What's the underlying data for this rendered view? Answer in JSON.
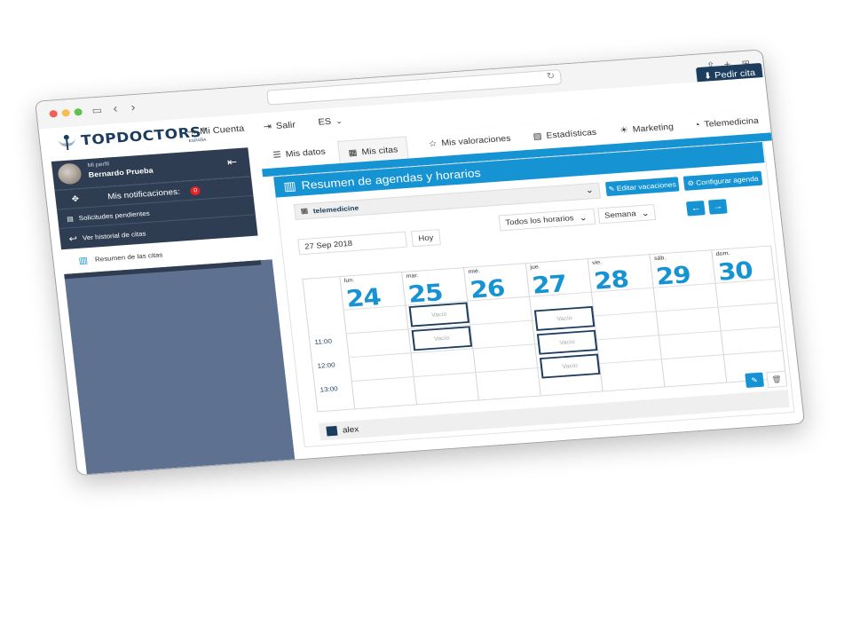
{
  "browser": {
    "pedir_cita": "Pedir cita"
  },
  "brand": {
    "logo_top": "TOP",
    "logo_doctors": "DOCTORS",
    "logo_sub": "ESPAÑA",
    "reg": "®",
    "accent_color": "#1593d3",
    "dark_color": "#1c3d5e"
  },
  "topnav": {
    "mi_cuenta": "Mi Cuenta",
    "salir": "Salir",
    "lang": "ES"
  },
  "sidebar": {
    "profile_caption": "Mi perfil",
    "profile_name": "Bernardo Prueba",
    "notifications_label": "Mis notificaciones:",
    "notifications_count": "0",
    "items": [
      {
        "label": "Solicitudes pendientes",
        "icon": "clipboard-icon"
      },
      {
        "label": "Ver historial de citas",
        "icon": "reply-icon"
      },
      {
        "label": "Resumen de las citas",
        "icon": "agenda-icon"
      }
    ]
  },
  "tabs": [
    {
      "label": "Mis datos",
      "icon": "list-icon"
    },
    {
      "label": "Mis citas",
      "icon": "calendar-icon"
    },
    {
      "label": "Mis valoraciones",
      "icon": "star-icon"
    },
    {
      "label": "Estadísticas",
      "icon": "chart-icon"
    },
    {
      "label": "Marketing",
      "icon": "bulb-icon"
    },
    {
      "label": "Telemedicina",
      "icon": "chat-icon"
    }
  ],
  "panel": {
    "title": "Resumen de agendas y horarios",
    "agenda_select": "telemedicine",
    "edit_vacations": "Editar vacaciones",
    "configure_agenda": "Configurar agenda",
    "date_value": "27 Sep 2018",
    "today": "Hoy",
    "schedule_select": "Todos los horarios",
    "view_select": "Semana",
    "prev_arrow": "←",
    "next_arrow": "→"
  },
  "calendar": {
    "days": [
      {
        "abbr": "lun.",
        "num": "24"
      },
      {
        "abbr": "mar.",
        "num": "25"
      },
      {
        "abbr": "mié.",
        "num": "26"
      },
      {
        "abbr": "jue.",
        "num": "27"
      },
      {
        "abbr": "vie.",
        "num": "28"
      },
      {
        "abbr": "sáb.",
        "num": "29"
      },
      {
        "abbr": "dom.",
        "num": "30"
      }
    ],
    "times": [
      "11:00",
      "12:00",
      "13:00"
    ],
    "slot_label": "Vacío"
  },
  "legend": {
    "name": "alex"
  }
}
